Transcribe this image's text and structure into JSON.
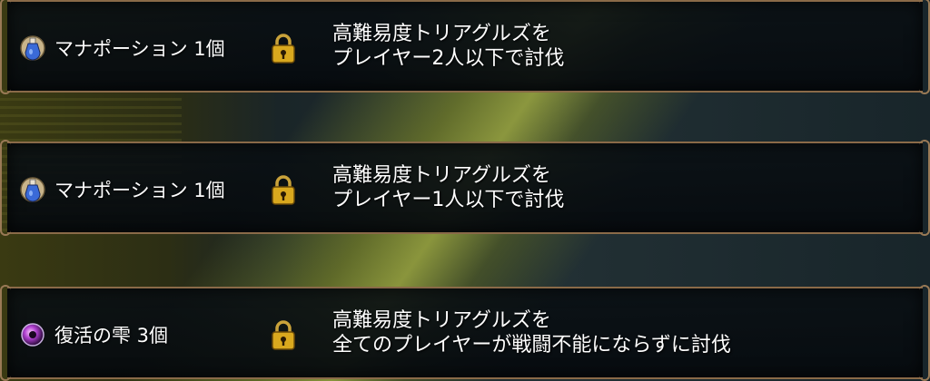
{
  "missions": [
    {
      "reward_icon": "mana-potion-icon",
      "reward": "マナポーション 1個",
      "locked": true,
      "condition_line1": "高難易度トリアグルズを",
      "condition_line2": "プレイヤー2人以下で討伐"
    },
    {
      "reward_icon": "mana-potion-icon",
      "reward": "マナポーション 1個",
      "locked": true,
      "condition_line1": "高難易度トリアグルズを",
      "condition_line2": "プレイヤー1人以下で討伐"
    },
    {
      "reward_icon": "revival-drop-icon",
      "reward": "復活の雫 3個",
      "locked": true,
      "condition_line1": "高難易度トリアグルズを",
      "condition_line2": "全てのプレイヤーが戦闘不能にならずに討伐"
    }
  ],
  "colors": {
    "frame_border": "#8a6a48",
    "lock_gold": "#d9a81e",
    "text": "#ffffff"
  }
}
